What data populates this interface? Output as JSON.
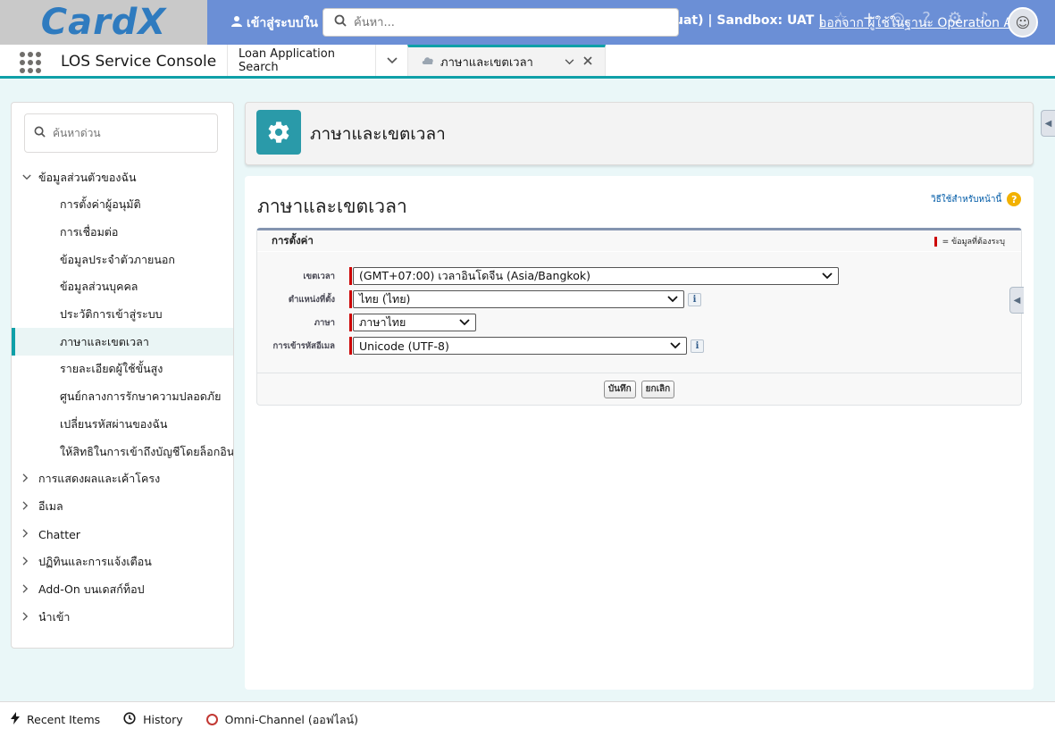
{
  "topbar": {
    "logo": "CardX",
    "login_as": "เข้าสู่ระบบใน",
    "sandbox": "uat) | Sandbox: UAT |",
    "logout_link": "ออกจาก ผู้ใช้ในฐานะ Operation Auth",
    "search_placeholder": "ค้นหา..."
  },
  "navbar": {
    "app_name": "LOS Service Console",
    "tabs": [
      {
        "label": "Loan Application Search"
      },
      {
        "label": "ภาษาและเขตเวลา",
        "active": true
      }
    ]
  },
  "sidebar": {
    "quick_find_placeholder": "ค้นหาด่วน",
    "sections": [
      {
        "label": "ข้อมูลส่วนตัวของฉัน",
        "expanded": true,
        "items": [
          "การตั้งค่าผู้อนุมัติ",
          "การเชื่อมต่อ",
          "ข้อมูลประจำตัวภายนอก",
          "ข้อมูลส่วนบุคคล",
          "ประวัติการเข้าสู่ระบบ",
          "ภาษาและเขตเวลา",
          "รายละเอียดผู้ใช้ขั้นสูง",
          "ศูนย์กลางการรักษาความปลอดภัย",
          "เปลี่ยนรหัสผ่านของฉัน",
          "ให้สิทธิในการเข้าถึงบัญชีโดยล็อกอิน"
        ],
        "selected_index": 5
      },
      {
        "label": "การแสดงผลและเค้าโครง"
      },
      {
        "label": "อีเมล"
      },
      {
        "label": "Chatter"
      },
      {
        "label": "ปฏิทินและการแจ้งเตือน"
      },
      {
        "label": "Add-On บนเดสก์ท็อป"
      },
      {
        "label": "นำเข้า"
      }
    ]
  },
  "header": {
    "title": "ภาษาและเขตเวลา"
  },
  "main": {
    "page_title": "ภาษาและเขตเวลา",
    "help_link": "วิธีใช้สำหรับหน้านี้",
    "section_title": "การตั้งค่า",
    "required_legend": "= ข้อมูลที่ต้องระบุ",
    "fields": [
      {
        "label": "เขตเวลา",
        "value": "(GMT+07:00) เวลาอินโดจีน (Asia/Bangkok)"
      },
      {
        "label": "ตำแหน่งที่ตั้ง",
        "value": "ไทย (ไทย)"
      },
      {
        "label": "ภาษา",
        "value": "ภาษาไทย"
      },
      {
        "label": "การเข้ารหัสอีเมล",
        "value": "Unicode (UTF-8)"
      }
    ],
    "save_label": "บันทึก",
    "cancel_label": "ยกเลิก",
    "info_glyph": "i"
  },
  "utility": {
    "recent_items": "Recent Items",
    "history": "History",
    "omni": "Omni-Channel (ออฟไลน์)"
  },
  "colors": {
    "brand_banner": "#6b8fd6",
    "accent_teal": "#0fa0a8",
    "required_red": "#c00000"
  }
}
